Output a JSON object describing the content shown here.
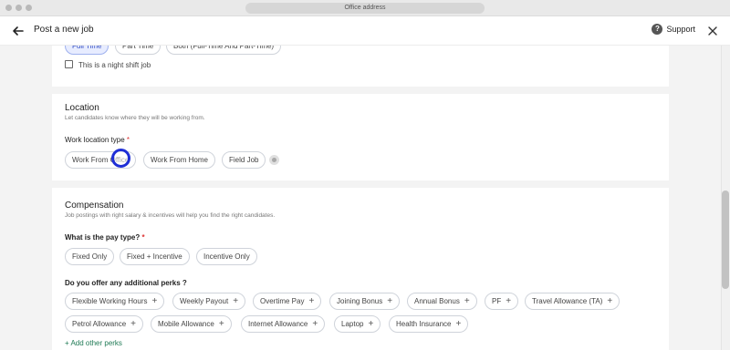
{
  "browser": {
    "url_title": "Office address"
  },
  "header": {
    "title": "Post a new job",
    "support_label": "Support"
  },
  "job_type": {
    "options": [
      "Full Time",
      "Part Time",
      "Both (Full-Time And Part-Time)"
    ],
    "selected": "Full Time",
    "night_shift_label": "This is a night shift job"
  },
  "location": {
    "title": "Location",
    "subtitle": "Let candidates know where they will be working from.",
    "type_label": "Work location type",
    "required_mark": "*",
    "options": [
      "Work From Office",
      "Work From Home",
      "Field Job"
    ]
  },
  "compensation": {
    "title": "Compensation",
    "subtitle": "Job postings with right salary & incentives will help you find the right candidates.",
    "pay_type_label": "What is the pay type?",
    "required_mark": "*",
    "pay_options": [
      "Fixed Only",
      "Fixed + Incentive",
      "Incentive Only"
    ],
    "perks_label": "Do you offer any additional perks ?",
    "perks": [
      "Flexible Working Hours",
      "Weekly Payout",
      "Overtime Pay",
      "Joining Bonus",
      "Annual Bonus",
      "PF",
      "Travel Allowance (TA)",
      "Petrol Allowance",
      "Mobile Allowance",
      "Internet Allowance",
      "Laptop",
      "Health Insurance"
    ],
    "plus_glyph": "+",
    "add_other_perks": "+ Add other perks"
  },
  "colors": {
    "accent": "#3650c4",
    "link": "#1f7a55",
    "cursor": "#1f2fd6"
  }
}
